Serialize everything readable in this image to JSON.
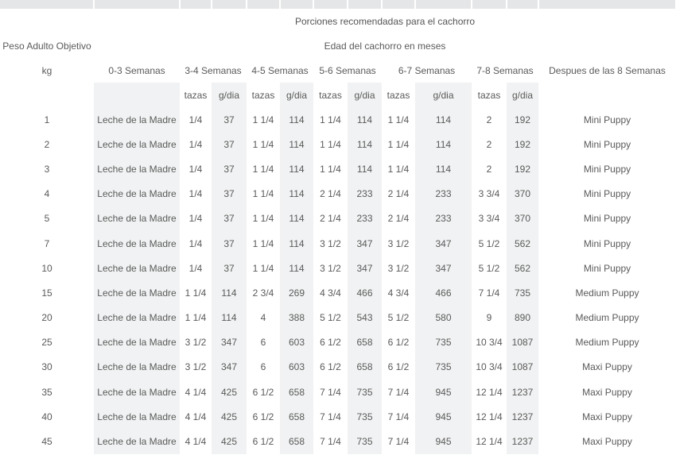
{
  "table": {
    "title": "Porciones recomendadas para el cachorro",
    "weight_header": "Peso Adulto Objetivo",
    "age_header": "Edad del cachorro en meses",
    "kg_label": "kg",
    "periods": [
      "0-3 Semanas",
      "3-4 Semanas",
      "4-5 Semanas",
      "5-6 Semanas",
      "6-7 Semanas",
      "7-8 Semanas",
      "Despues de las 8 Semanas"
    ],
    "cups_label": "tazas",
    "grams_label": "g/dia",
    "rows": [
      [
        "1",
        "Leche de la Madre",
        "1/4",
        "37",
        "1 1/4",
        "114",
        "1 1/4",
        "114",
        "1 1/4",
        "114",
        "2",
        "192",
        "Mini Puppy"
      ],
      [
        "2",
        "Leche de la Madre",
        "1/4",
        "37",
        "1 1/4",
        "114",
        "1 1/4",
        "114",
        "1 1/4",
        "114",
        "2",
        "192",
        "Mini Puppy"
      ],
      [
        "3",
        "Leche de la Madre",
        "1/4",
        "37",
        "1 1/4",
        "114",
        "1 1/4",
        "114",
        "1 1/4",
        "114",
        "2",
        "192",
        "Mini Puppy"
      ],
      [
        "4",
        "Leche de la Madre",
        "1/4",
        "37",
        "1 1/4",
        "114",
        "2 1/4",
        "233",
        "2 1/4",
        "233",
        "3 3/4",
        "370",
        "Mini Puppy"
      ],
      [
        "5",
        "Leche de la Madre",
        "1/4",
        "37",
        "1 1/4",
        "114",
        "2 1/4",
        "233",
        "2 1/4",
        "233",
        "3 3/4",
        "370",
        "Mini Puppy"
      ],
      [
        "7",
        "Leche de la Madre",
        "1/4",
        "37",
        "1 1/4",
        "114",
        "3 1/2",
        "347",
        "3 1/2",
        "347",
        "5 1/2",
        "562",
        "Mini Puppy"
      ],
      [
        "10",
        "Leche de la Madre",
        "1/4",
        "37",
        "1 1/4",
        "114",
        "3 1/2",
        "347",
        "3 1/2",
        "347",
        "5 1/2",
        "562",
        "Mini Puppy"
      ],
      [
        "15",
        "Leche de la Madre",
        "1 1/4",
        "114",
        "2 3/4",
        "269",
        "4 3/4",
        "466",
        "4 3/4",
        "466",
        "7 1/4",
        "735",
        "Medium Puppy"
      ],
      [
        "20",
        "Leche de la Madre",
        "1 1/4",
        "114",
        "4",
        "388",
        "5 1/2",
        "543",
        "5 1/2",
        "580",
        "9",
        "890",
        "Medium Puppy"
      ],
      [
        "25",
        "Leche de la Madre",
        "3 1/2",
        "347",
        "6",
        "603",
        "6 1/2",
        "658",
        "6 1/2",
        "735",
        "10 3/4",
        "1087",
        "Medium Puppy"
      ],
      [
        "30",
        "Leche de la Madre",
        "3 1/2",
        "347",
        "6",
        "603",
        "6 1/2",
        "658",
        "6 1/2",
        "735",
        "10 3/4",
        "1087",
        "Maxi Puppy"
      ],
      [
        "35",
        "Leche de la Madre",
        "4 1/4",
        "425",
        "6 1/2",
        "658",
        "7 1/4",
        "735",
        "7 1/4",
        "945",
        "12 1/4",
        "1237",
        "Maxi Puppy"
      ],
      [
        "40",
        "Leche de la Madre",
        "4 1/4",
        "425",
        "6 1/2",
        "658",
        "7 1/4",
        "735",
        "7 1/4",
        "945",
        "12 1/4",
        "1237",
        "Maxi Puppy"
      ],
      [
        "45",
        "Leche de la Madre",
        "4 1/4",
        "425",
        "6 1/2",
        "658",
        "7 1/4",
        "735",
        "7 1/4",
        "945",
        "12 1/4",
        "1237",
        "Maxi Puppy"
      ]
    ]
  },
  "colors": {
    "text": "#5a5a5a",
    "shaded_column": "#f1f2f3",
    "header_strip": "#e4e6e8",
    "background": "#ffffff"
  }
}
